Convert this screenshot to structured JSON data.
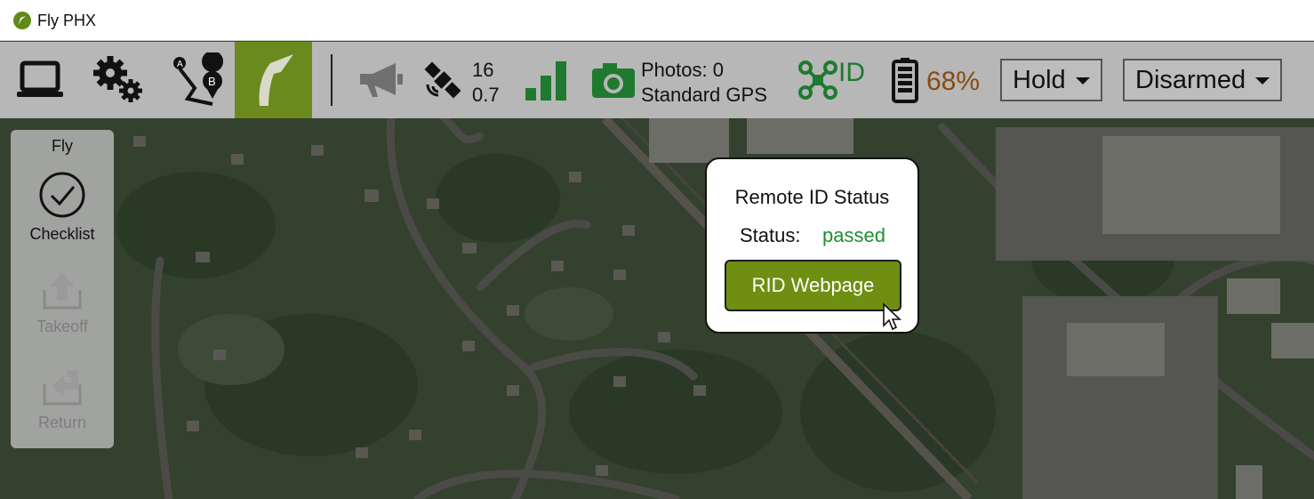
{
  "window": {
    "title": "Fly PHX"
  },
  "toolbar": {
    "icons": [
      "laptop-icon",
      "gears-icon",
      "route-a-b-icon",
      "plane-icon",
      "megaphone-icon",
      "satellite-icon",
      "signal-bars-icon",
      "camera-icon",
      "drone-id-icon",
      "battery-icon"
    ],
    "satellite": {
      "count": "16",
      "hdop": "0.7"
    },
    "camera": {
      "photos": "Photos: 0",
      "mode": "Standard GPS"
    },
    "remote_id_label": "ID",
    "battery": "68%",
    "flight_mode": "Hold",
    "arm_state": "Disarmed",
    "colors": {
      "active": "#6a8a1d",
      "green": "#1e7a2f",
      "battery": "#8a4a10"
    }
  },
  "fly_panel": {
    "title": "Fly",
    "items": [
      {
        "label": "Checklist",
        "icon": "checkmark-circle-icon",
        "enabled": true
      },
      {
        "label": "Takeoff",
        "icon": "takeoff-icon",
        "enabled": false
      },
      {
        "label": "Return",
        "icon": "return-icon",
        "enabled": false
      }
    ]
  },
  "popup": {
    "title": "Remote ID Status",
    "status_label": "Status:",
    "status_value": "passed",
    "button_label": "RID Webpage"
  }
}
